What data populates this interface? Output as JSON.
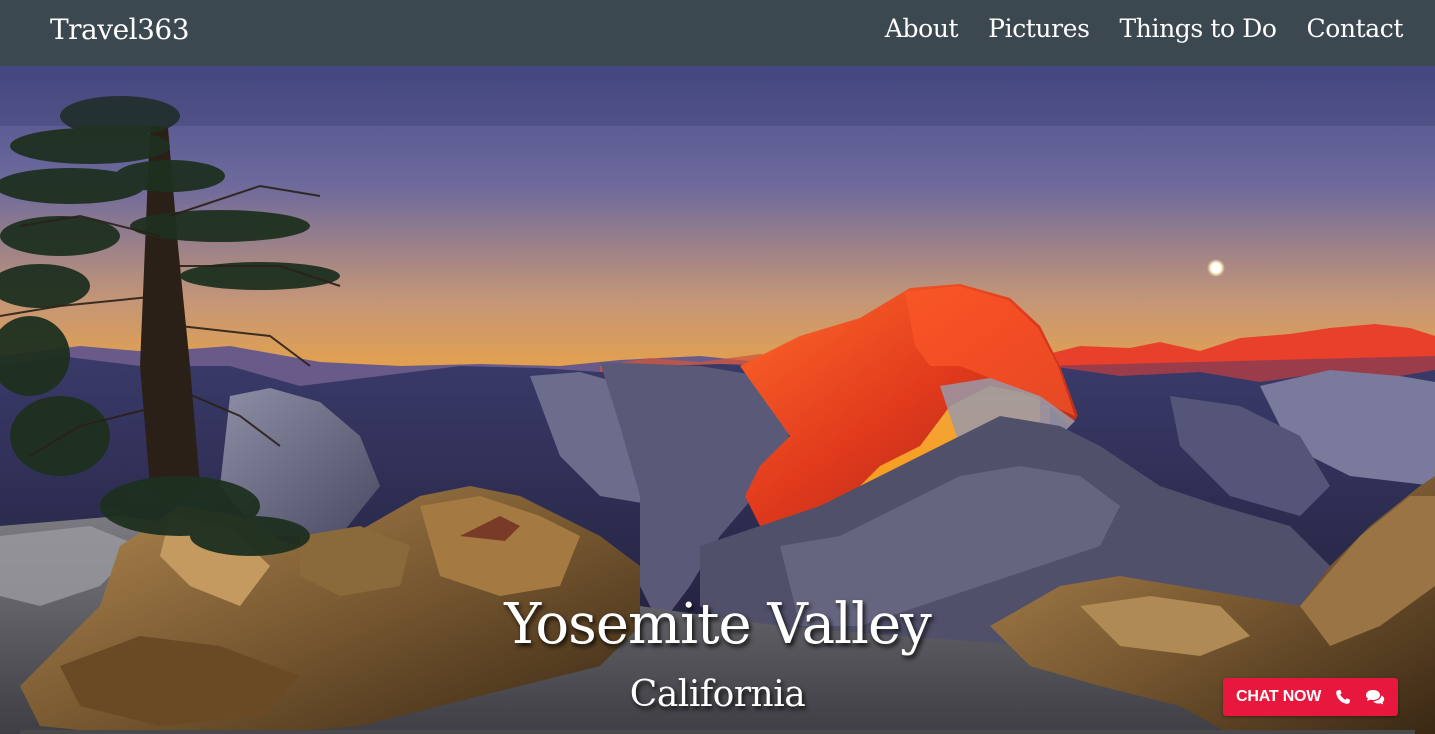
{
  "nav": {
    "brand": "Travel363",
    "links": [
      {
        "label": "About"
      },
      {
        "label": "Pictures"
      },
      {
        "label": "Things to Do"
      },
      {
        "label": "Contact"
      }
    ],
    "background": "#3c4850"
  },
  "hero": {
    "title": "Yosemite Valley",
    "subtitle": "California"
  },
  "chat": {
    "label": "CHAT NOW",
    "icons": [
      "phone-icon",
      "chat-bubbles-icon"
    ],
    "color": "#e8173d"
  }
}
